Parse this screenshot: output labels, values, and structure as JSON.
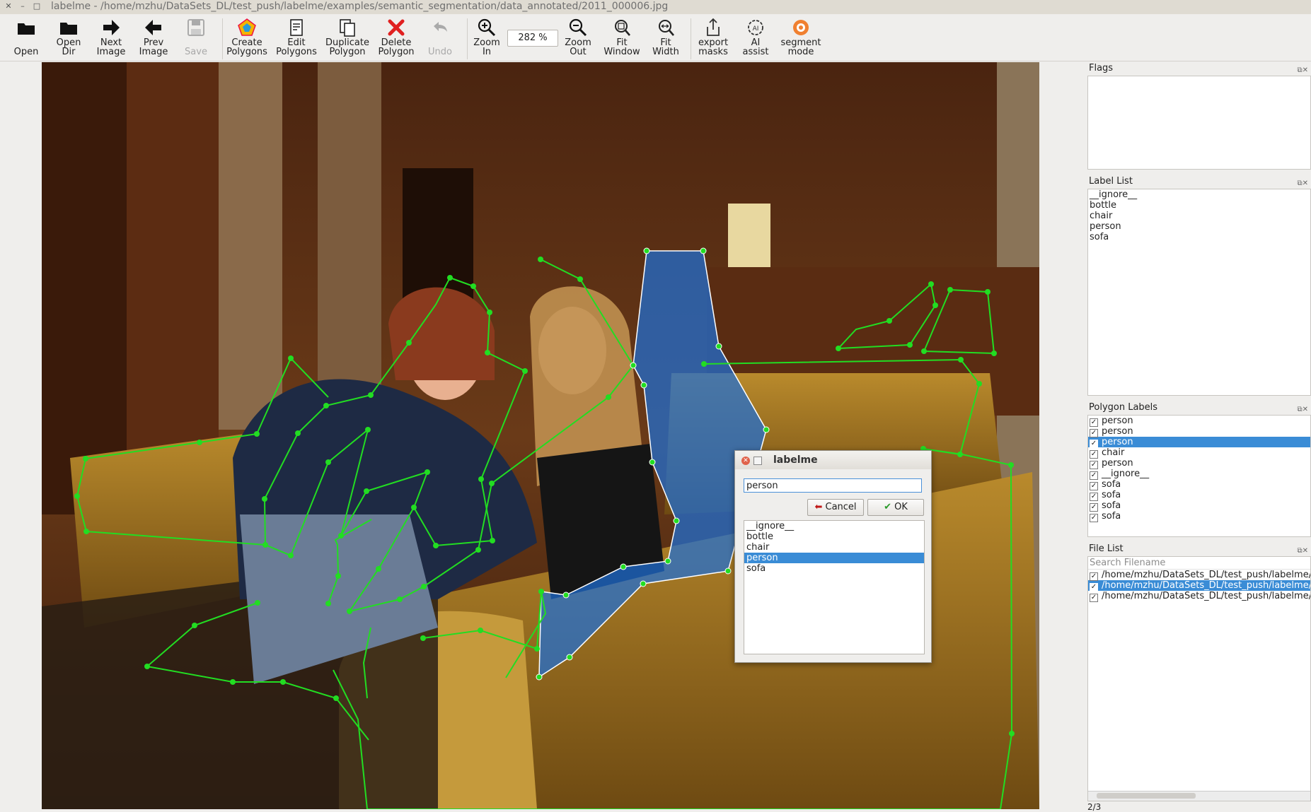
{
  "window": {
    "title": "labelme - /home/mzhu/DataSets_DL/test_push/labelme/examples/semantic_segmentation/data_annotated/2011_000006.jpg"
  },
  "toolbar": {
    "open": "Open",
    "open_dir": [
      "Open",
      "Dir"
    ],
    "next_image": [
      "Next",
      "Image"
    ],
    "prev_image": [
      "Prev",
      "Image"
    ],
    "save": "Save",
    "create_polygons": [
      "Create",
      "Polygons"
    ],
    "edit_polygons": [
      "Edit",
      "Polygons"
    ],
    "duplicate_polygon": [
      "Duplicate",
      "Polygon"
    ],
    "delete_polygon": [
      "Delete",
      "Polygon"
    ],
    "undo": "Undo",
    "zoom_in": [
      "Zoom",
      "In"
    ],
    "zoom_value": "282 %",
    "zoom_out": [
      "Zoom",
      "Out"
    ],
    "fit_window": [
      "Fit",
      "Window"
    ],
    "fit_width": [
      "Fit",
      "Width"
    ],
    "export_masks": [
      "export",
      "masks"
    ],
    "ai_assist": [
      "AI",
      "assist"
    ],
    "segment_mode": [
      "segment",
      "mode"
    ]
  },
  "dialog": {
    "title": "labelme",
    "input_value": "person",
    "cancel": "Cancel",
    "ok": "OK",
    "labels": [
      "__ignore__",
      "bottle",
      "chair",
      "person",
      "sofa"
    ],
    "selected_index": 3
  },
  "docks": {
    "flags_title": "Flags",
    "label_list_title": "Label List",
    "label_list": [
      "__ignore__",
      "bottle",
      "chair",
      "person",
      "sofa"
    ],
    "polygon_labels_title": "Polygon Labels",
    "polygon_labels": [
      "person",
      "person",
      "person",
      "chair",
      "person",
      "__ignore__",
      "sofa",
      "sofa",
      "sofa",
      "sofa"
    ],
    "polygon_selected_index": 2,
    "file_list_title": "File List",
    "search_placeholder": "Search Filename",
    "files": [
      "/home/mzhu/DataSets_DL/test_push/labelme/exa",
      "/home/mzhu/DataSets_DL/test_push/labelme/exa",
      "/home/mzhu/DataSets_DL/test_push/labelme/exa"
    ],
    "file_selected_index": 1
  },
  "status": {
    "counter": "2/3"
  },
  "colors": {
    "polygon_line": "#22dd22",
    "selected_fill": "#1f6fd6",
    "selection": "#3a8cd6"
  },
  "icons": [
    "folder-open-icon",
    "folder-icon",
    "arrow-right-icon",
    "arrow-left-icon",
    "floppy-icon",
    "polygon-create-icon",
    "edit-icon",
    "duplicate-icon",
    "delete-x-icon",
    "undo-icon",
    "zoom-in-icon",
    "zoom-out-icon",
    "fit-window-icon",
    "fit-width-icon",
    "export-icon",
    "ai-assist-icon",
    "segment-mode-icon"
  ]
}
